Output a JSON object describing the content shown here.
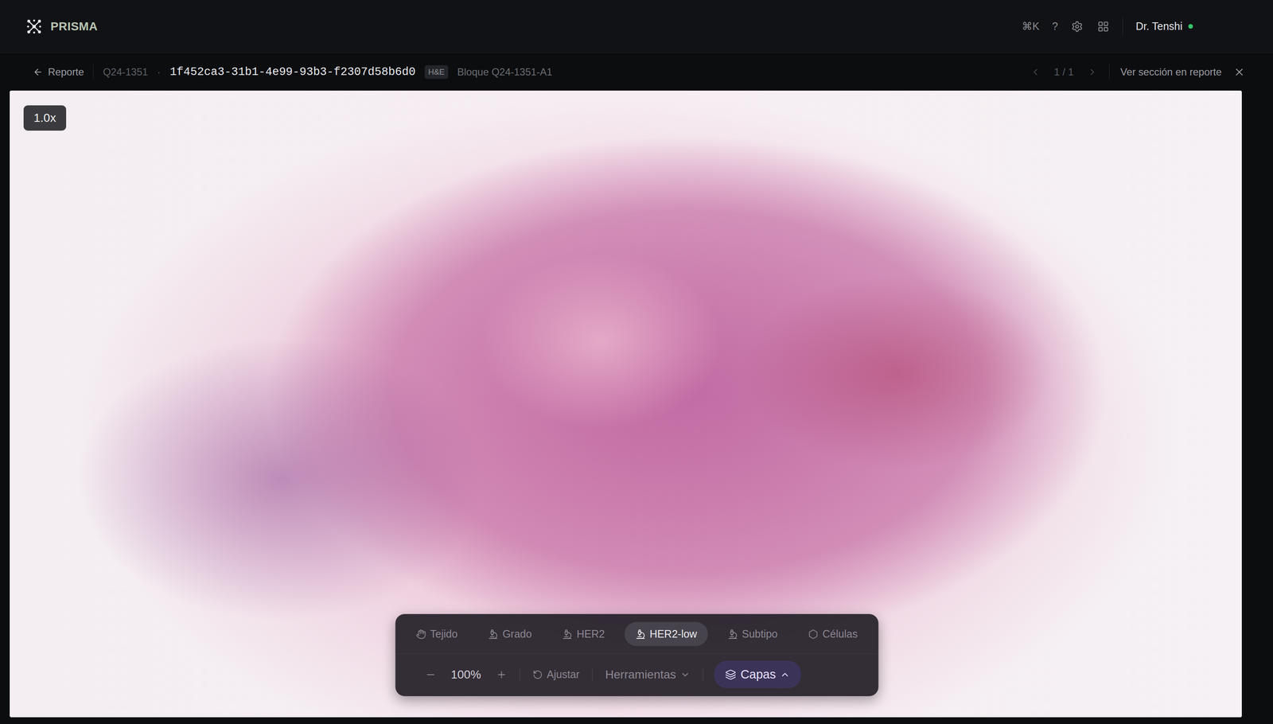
{
  "header": {
    "app_name": "PRISMA",
    "shortcut": "⌘K",
    "help": "?",
    "user": "Dr. Tenshi",
    "online": true
  },
  "subbar": {
    "back": "Reporte",
    "case": "Q24-1351",
    "separator": "·",
    "slide_id": "1f452ca3-31b1-4e99-93b3-f2307d58b6d0",
    "stain": "H&E",
    "block": "Bloque Q24-1351-A1",
    "pager": "1 / 1",
    "link": "Ver sección en reporte"
  },
  "viewer": {
    "zoom_badge": "1.0x"
  },
  "toolbar": {
    "tabs": [
      {
        "label": "Tejido",
        "kind": "tissue",
        "selected": false
      },
      {
        "label": "Grado",
        "kind": "model",
        "selected": false
      },
      {
        "label": "HER2",
        "kind": "model",
        "selected": false
      },
      {
        "label": "HER2-low",
        "kind": "model",
        "selected": true
      },
      {
        "label": "Subtipo",
        "kind": "model",
        "selected": false
      },
      {
        "label": "Células",
        "kind": "cells",
        "selected": false
      }
    ],
    "zoom": "100%",
    "fit": "Ajustar",
    "tools": {
      "label": "Herramientas",
      "expanded": false
    },
    "layers": {
      "label": "Capas",
      "selected": true,
      "expanded": true
    }
  }
}
